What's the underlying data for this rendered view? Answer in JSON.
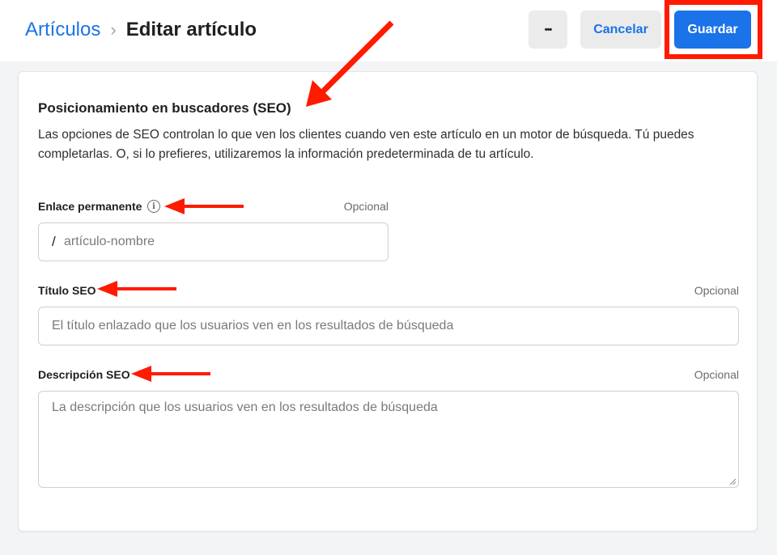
{
  "header": {
    "breadcrumb_parent": "Artículos",
    "breadcrumb_separator": "›",
    "page_title": "Editar artículo",
    "more_label": "•••",
    "cancel_label": "Cancelar",
    "save_label": "Guardar"
  },
  "seo": {
    "title": "Posicionamiento en buscadores (SEO)",
    "description": "Las opciones de SEO controlan lo que ven los clientes cuando ven este artículo en un motor de búsqueda. Tú puedes completarlas. O, si lo prefieres, utilizaremos la información predeterminada de tu artículo.",
    "permalink": {
      "label": "Enlace permanente",
      "optional": "Opcional",
      "prefix": "/",
      "placeholder": "artículo-nombre",
      "info_icon": "info-icon"
    },
    "seo_title": {
      "label": "Título SEO",
      "optional": "Opcional",
      "placeholder": "El título enlazado que los usuarios ven en los resultados de búsqueda"
    },
    "seo_description": {
      "label": "Descripción SEO",
      "optional": "Opcional",
      "placeholder": "La descripción que los usuarios ven en los resultados de búsqueda"
    }
  },
  "colors": {
    "accent": "#1a73e8",
    "annotation": "#ff1a00",
    "background": "#f3f4f6"
  }
}
